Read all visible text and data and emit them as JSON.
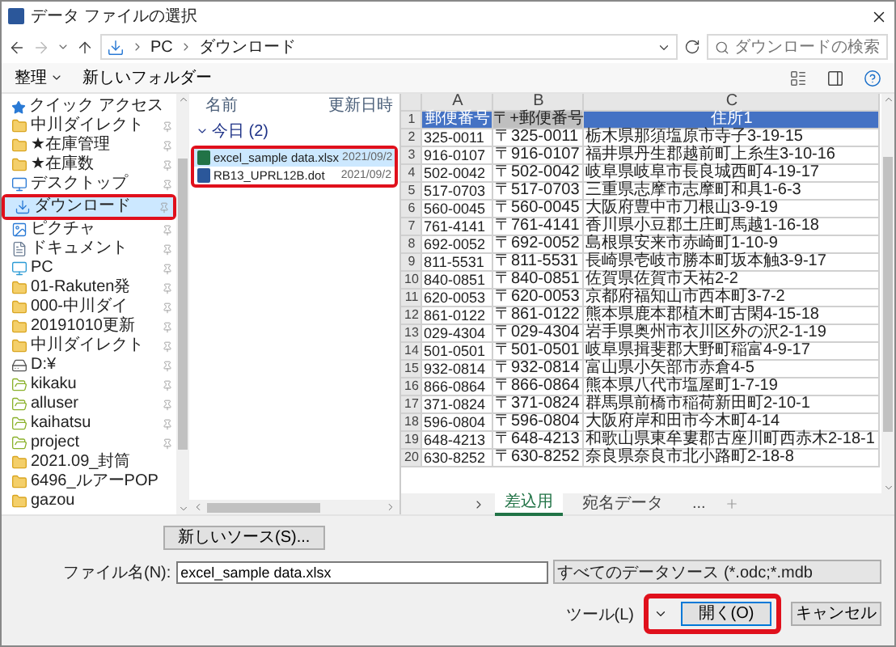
{
  "window": {
    "title": "データ ファイルの選択"
  },
  "address": {
    "path": [
      "PC",
      "ダウンロード"
    ]
  },
  "search": {
    "placeholder": "ダウンロードの検索"
  },
  "toolbar": {
    "organize": "整理",
    "new_folder": "新しいフォルダー"
  },
  "sidebar": {
    "items": [
      {
        "label": "クイック アクセス",
        "kind": "quick",
        "pinned": false,
        "selected": false,
        "highlighted": false
      },
      {
        "label": "中川ダイレクト",
        "kind": "folder",
        "pinned": true,
        "selected": false,
        "highlighted": false
      },
      {
        "label": "★在庫管理",
        "kind": "folder",
        "pinned": true,
        "selected": false,
        "highlighted": false
      },
      {
        "label": "★在庫数",
        "kind": "folder",
        "pinned": true,
        "selected": false,
        "highlighted": false
      },
      {
        "label": "デスクトップ",
        "kind": "desktop",
        "pinned": true,
        "selected": false,
        "highlighted": false
      },
      {
        "label": "ダウンロード",
        "kind": "download",
        "pinned": true,
        "selected": true,
        "highlighted": true
      },
      {
        "label": "ピクチャ",
        "kind": "pictures",
        "pinned": true,
        "selected": false,
        "highlighted": false
      },
      {
        "label": "ドキュメント",
        "kind": "documents",
        "pinned": true,
        "selected": false,
        "highlighted": false
      },
      {
        "label": "PC",
        "kind": "pc",
        "pinned": true,
        "selected": false,
        "highlighted": false
      },
      {
        "label": "01-Rakuten発",
        "kind": "folder",
        "pinned": true,
        "selected": false,
        "highlighted": false
      },
      {
        "label": "000-中川ダイ",
        "kind": "folder",
        "pinned": true,
        "selected": false,
        "highlighted": false
      },
      {
        "label": "20191010更新",
        "kind": "folder",
        "pinned": true,
        "selected": false,
        "highlighted": false
      },
      {
        "label": "中川ダイレクト",
        "kind": "folder",
        "pinned": true,
        "selected": false,
        "highlighted": false
      },
      {
        "label": "D:¥",
        "kind": "drive",
        "pinned": true,
        "selected": false,
        "highlighted": false
      },
      {
        "label": "kikaku",
        "kind": "shared",
        "pinned": true,
        "selected": false,
        "highlighted": false
      },
      {
        "label": "alluser",
        "kind": "shared",
        "pinned": true,
        "selected": false,
        "highlighted": false
      },
      {
        "label": "kaihatsu",
        "kind": "shared",
        "pinned": true,
        "selected": false,
        "highlighted": false
      },
      {
        "label": "project",
        "kind": "shared",
        "pinned": true,
        "selected": false,
        "highlighted": false
      },
      {
        "label": "2021.09_封筒",
        "kind": "folder",
        "pinned": false,
        "selected": false,
        "highlighted": false
      },
      {
        "label": "6496_ルアーPOP",
        "kind": "folder",
        "pinned": false,
        "selected": false,
        "highlighted": false
      },
      {
        "label": "gazou",
        "kind": "folder",
        "pinned": false,
        "selected": false,
        "highlighted": false
      }
    ]
  },
  "file_list": {
    "columns": [
      "名前",
      "更新日時"
    ],
    "group": {
      "label": "今日 (2)",
      "expanded": true
    },
    "highlighted": true,
    "files": [
      {
        "name": "excel_sample data.xlsx",
        "date": "2021/09/2",
        "kind": "excel",
        "selected": true
      },
      {
        "name": "RB13_UPRL12B.dot",
        "date": "2021/09/2",
        "kind": "word",
        "selected": false
      }
    ]
  },
  "preview": {
    "column_letters": [
      "A",
      "B",
      "C"
    ],
    "header": {
      "num": "1",
      "cells": [
        {
          "text": "郵便番号",
          "color": "#4472c4"
        },
        {
          "text": "〒+郵便番号",
          "color": "#bfbfbf"
        },
        {
          "text": "住所1",
          "color": "#4472c4"
        }
      ]
    },
    "rows": [
      {
        "num": "2",
        "cells": [
          "325-0011",
          "〒325-0011",
          "栃木県那須塩原市寺子3-19-15"
        ]
      },
      {
        "num": "3",
        "cells": [
          "916-0107",
          "〒916-0107",
          "福井県丹生郡越前町上糸生3-10-16"
        ]
      },
      {
        "num": "4",
        "cells": [
          "502-0042",
          "〒502-0042",
          "岐阜県岐阜市長良城西町4-19-17"
        ]
      },
      {
        "num": "5",
        "cells": [
          "517-0703",
          "〒517-0703",
          "三重県志摩市志摩町和具1-6-3"
        ]
      },
      {
        "num": "6",
        "cells": [
          "560-0045",
          "〒560-0045",
          "大阪府豊中市刀根山3-9-19"
        ]
      },
      {
        "num": "7",
        "cells": [
          "761-4141",
          "〒761-4141",
          "香川県小豆郡土庄町馬越1-16-18"
        ]
      },
      {
        "num": "8",
        "cells": [
          "692-0052",
          "〒692-0052",
          "島根県安来市赤崎町1-10-9"
        ]
      },
      {
        "num": "9",
        "cells": [
          "811-5531",
          "〒811-5531",
          "長崎県壱岐市勝本町坂本触3-9-17"
        ]
      },
      {
        "num": "10",
        "cells": [
          "840-0851",
          "〒840-0851",
          "佐賀県佐賀市天祐2-2"
        ]
      },
      {
        "num": "11",
        "cells": [
          "620-0053",
          "〒620-0053",
          "京都府福知山市西本町3-7-2"
        ]
      },
      {
        "num": "12",
        "cells": [
          "861-0122",
          "〒861-0122",
          "熊本県鹿本郡植木町古閑4-15-18"
        ]
      },
      {
        "num": "13",
        "cells": [
          "029-4304",
          "〒029-4304",
          "岩手県奥州市衣川区外の沢2-1-19"
        ]
      },
      {
        "num": "14",
        "cells": [
          "501-0501",
          "〒501-0501",
          "岐阜県揖斐郡大野町稲富4-9-17"
        ]
      },
      {
        "num": "15",
        "cells": [
          "932-0814",
          "〒932-0814",
          "富山県小矢部市赤倉4-5"
        ]
      },
      {
        "num": "16",
        "cells": [
          "866-0864",
          "〒866-0864",
          "熊本県八代市塩屋町1-7-19"
        ]
      },
      {
        "num": "17",
        "cells": [
          "371-0824",
          "〒371-0824",
          "群馬県前橋市稲荷新田町2-10-1"
        ]
      },
      {
        "num": "18",
        "cells": [
          "596-0804",
          "〒596-0804",
          "大阪府岸和田市今木町4-14"
        ]
      },
      {
        "num": "19",
        "cells": [
          "648-4213",
          "〒648-4213",
          "和歌山県東牟婁郡古座川町西赤木2-18-1"
        ]
      },
      {
        "num": "20",
        "cells": [
          "630-8252",
          "〒630-8252",
          "奈良県奈良市北小路町2-18-8"
        ]
      }
    ],
    "sheet_tabs": [
      {
        "label": "差込用",
        "selected": true
      },
      {
        "label": "宛名データ",
        "selected": false
      }
    ],
    "more_tabs": "..."
  },
  "new_source_button": "新しいソース(S)...",
  "filename": {
    "label": "ファイル名(N):",
    "value": "excel_sample data.xlsx"
  },
  "filetype": {
    "value": "すべてのデータソース (*.odc;*.mdb"
  },
  "tools": {
    "label": "ツール(L)"
  },
  "open_button": {
    "label": "開く(O)",
    "highlighted": true
  },
  "cancel_button": "キャンセル"
}
